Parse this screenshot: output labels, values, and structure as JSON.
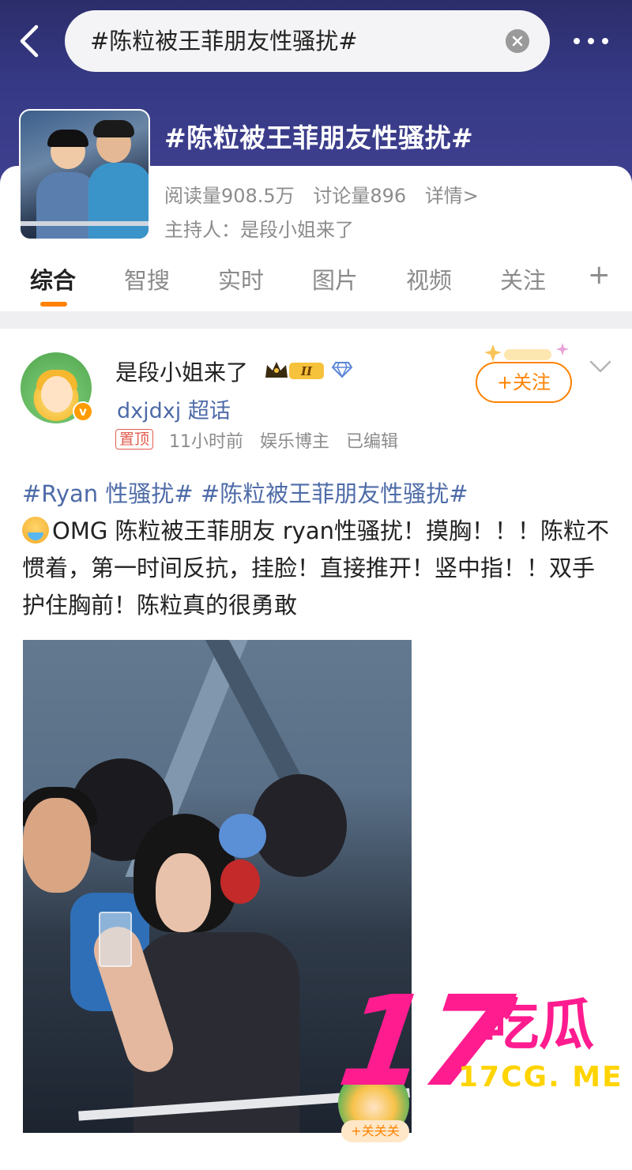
{
  "search": {
    "query": "#陈粒被王菲朋友性骚扰#"
  },
  "topic": {
    "title": "#陈粒被王菲朋友性骚扰#",
    "reads": "阅读量908.5万",
    "discussions": "讨论量896",
    "details": "详情>",
    "host": "主持人：是段小姐来了"
  },
  "tabs": [
    {
      "label": "综合",
      "active": true
    },
    {
      "label": "智搜"
    },
    {
      "label": "实时"
    },
    {
      "label": "图片"
    },
    {
      "label": "视频"
    },
    {
      "label": "关注"
    }
  ],
  "tab_add": "+",
  "post": {
    "username": "是段小姐来了",
    "level_badge": "II",
    "supertopic": "dxjdxj 超话",
    "pinned": "置顶",
    "time": "11小时前",
    "role": "娱乐博主",
    "edited": "已编辑",
    "follow": "+关注",
    "tags": "#Ryan 性骚扰# #陈粒被王菲朋友性骚扰#",
    "body": "OMG 陈粒被王菲朋友 ryan性骚扰！摸胸！！！陈粒不惯着，第一时间反抗，挂脸！直接推开！竖中指！！双手护住胸前！陈粒真的很勇敢",
    "sticker_follow": "+关关关"
  },
  "watermark": {
    "number": "17",
    "chinese": "吃瓜",
    "url": "17CG. ME"
  },
  "colors": {
    "accent": "#ff8200",
    "link": "#4e6ba8",
    "header": "#363a86",
    "watermark": "#ff1c8f"
  }
}
